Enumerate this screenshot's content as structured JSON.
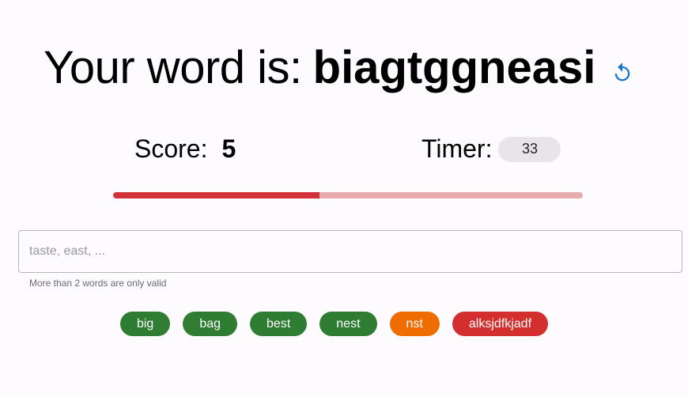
{
  "header": {
    "prefix": "Your word is:",
    "word": "biagtggneasi",
    "refresh_icon": "refresh-icon",
    "accent_color": "#1976d2"
  },
  "stats": {
    "score_label": "Score:",
    "score_value": "5",
    "timer_label": "Timer:",
    "timer_value": "33",
    "progress_fraction": 0.44,
    "progress_color": "#d13238",
    "progress_track_color": "#e6acab"
  },
  "input": {
    "value": "",
    "placeholder": "taste, east, ...",
    "helper_text": "More than 2 words are only valid"
  },
  "words": [
    {
      "text": "big",
      "status": "valid",
      "color": "#2e7d32"
    },
    {
      "text": "bag",
      "status": "valid",
      "color": "#2e7d32"
    },
    {
      "text": "best",
      "status": "valid",
      "color": "#2e7d32"
    },
    {
      "text": "nest",
      "status": "valid",
      "color": "#2e7d32"
    },
    {
      "text": "nst",
      "status": "warning",
      "color": "#ef6c00"
    },
    {
      "text": "alksjdfkjadf",
      "status": "invalid",
      "color": "#d32f2f"
    }
  ]
}
